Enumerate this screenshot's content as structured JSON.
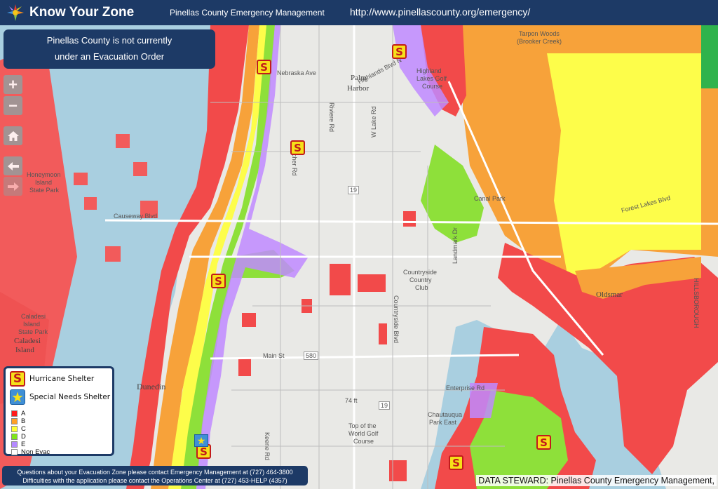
{
  "header": {
    "title": "Know Your Zone",
    "agency": "Pinellas County Emergency Management",
    "url": "http://www.pinellascounty.org/emergency/"
  },
  "status": {
    "line1": "Pinellas County is not currently",
    "line2": "under an Evacuation Order"
  },
  "controls": {
    "zoom_in": "+",
    "zoom_out": "−",
    "home_icon": "home-icon",
    "back_icon": "arrow-left-icon"
  },
  "legend": {
    "hurricane_shelter": "Hurricane Shelter",
    "special_needs_shelter": "Special Needs Shelter",
    "shelter_symbol": "S",
    "zones": [
      {
        "label": "A",
        "color": "#ff1a1a"
      },
      {
        "label": "B",
        "color": "#ffa126"
      },
      {
        "label": "C",
        "color": "#ffff33"
      },
      {
        "label": "D",
        "color": "#80e619"
      },
      {
        "label": "E",
        "color": "#b58aff"
      },
      {
        "label": "Non Evac",
        "color": "#ffffff"
      }
    ]
  },
  "contact": {
    "line1": "Questions about your Evacuation Zone please contact Emergency Management at (727) 464-3800",
    "line2": "Difficulties with the application please contact the Operations Center at (727) 453-HELP (4357)"
  },
  "steward": "DATA STEWARD: Pinellas County Emergency Management,",
  "map_labels": {
    "palm": "Palm",
    "harbor": "Harbor",
    "highland1": "Highland",
    "highland2": "Lakes Golf",
    "highland3": "Course",
    "tarpon1": "Tarpon Woods",
    "tarpon2": "(Brooker Creek)",
    "countryside1": "Countryside",
    "countryside2": "Country",
    "countryside3": "Club",
    "oldsmar": "Oldsmar",
    "dunedin": "Dunedin",
    "caladesi1": "Caladesi",
    "caladesi2": "Island",
    "caladesi3": "State Park",
    "caladesi4": "Caladesi",
    "caladesi5": "Island",
    "honeymoon1": "Honeymoon",
    "honeymoon2": "Island",
    "honeymoon3": "State Park",
    "causeway": "Causeway Blvd",
    "main_st": "Main St",
    "enterprise": "Enterprise Rd",
    "chautauqua1": "Chautauqua",
    "chautauqua2": "Park East",
    "topworld1": "Top of the",
    "topworld2": "World Golf",
    "topworld3": "Course",
    "nebraska": "Nebraska Ave",
    "belcher": "Belcher Rd",
    "riviere": "Riviere Rd",
    "w_lake": "W Lake Rd",
    "keene": "Keene Rd",
    "hillsborough": "HILLSBOROUGH",
    "forest_lakes": "Forest Lakes Blvd",
    "canal_park": "Canal Park",
    "landmark": "Landmark Dr",
    "countryside_blvd": "Countryside Blvd",
    "highlands_blvd": "Highlands Blvd N",
    "r19": "19",
    "r580": "580",
    "ave_74": "74 ft"
  }
}
